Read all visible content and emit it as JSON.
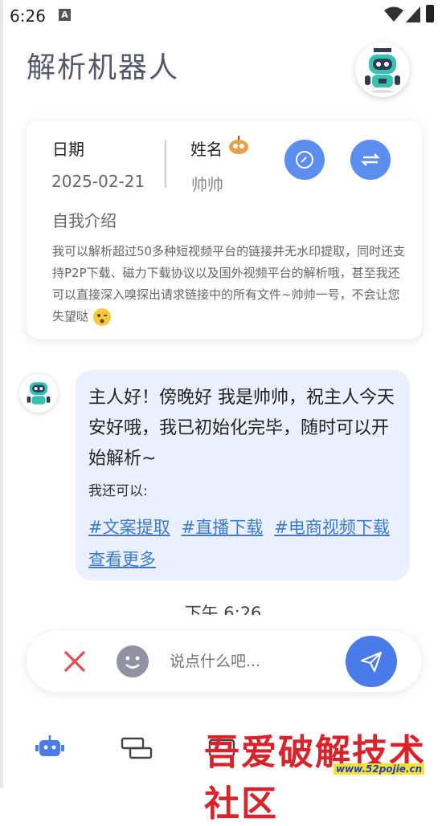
{
  "status_bar": {
    "time": "6:26",
    "notif_letter": "A"
  },
  "header": {
    "title": "解析机器人"
  },
  "info_card": {
    "date_label": "日期",
    "date_value": "2025-02-21",
    "name_label": "姓名",
    "name_value": "帅帅",
    "intro_label": "自我介绍",
    "intro_text": "我可以解析超过50多种短视频平台的链接并无水印提取，同时还支持P2P下载、磁力下载协议以及国外视频平台的解析哦，甚至我还可以直接深入嗅探出请求链接中的所有文件~帅帅一号，不会让您失望哒"
  },
  "chat": {
    "message": "主人好！傍晚好 我是帅帅，祝主人今天安好哦，我已初始化完毕，随时可以开始解析~",
    "can_do_label": "我还可以:",
    "links": [
      "#文案提取",
      "#直播下载",
      "#电商视频下载",
      "查看更多"
    ],
    "timestamp": "下午 6:26"
  },
  "input": {
    "placeholder": "说点什么吧..."
  },
  "watermark": {
    "text": "吾爱破解技术社区",
    "url": "www.52pojie.cn"
  },
  "colors": {
    "accent": "#4a7be8",
    "circle_button": "#5b8ef0",
    "bubble_bg": "#eaf0fd",
    "close": "#e05050"
  }
}
